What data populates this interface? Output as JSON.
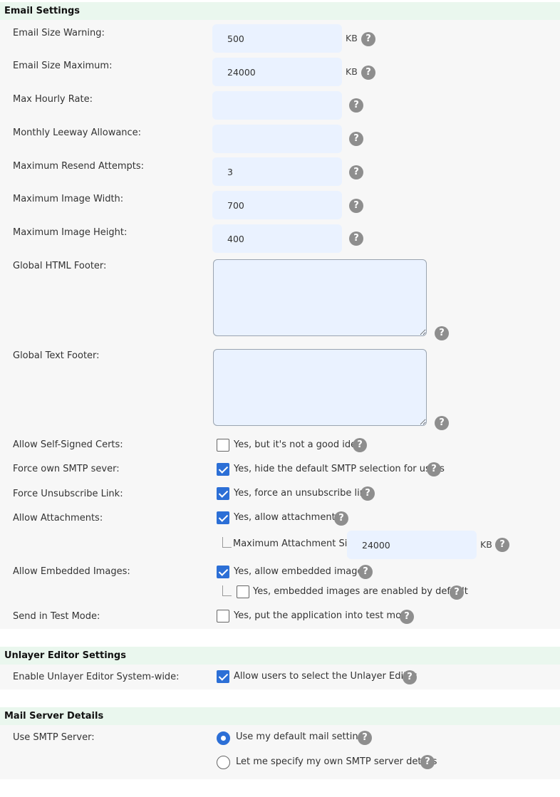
{
  "help_glyph": "?",
  "email_settings": {
    "title": "Email Settings",
    "size_warning": {
      "label": "Email Size Warning:",
      "value": "500",
      "unit": "KB"
    },
    "size_maximum": {
      "label": "Email Size Maximum:",
      "value": "24000",
      "unit": "KB"
    },
    "max_hourly_rate": {
      "label": "Max Hourly Rate:",
      "value": ""
    },
    "monthly_leeway": {
      "label": "Monthly Leeway Allowance:",
      "value": ""
    },
    "max_resend": {
      "label": "Maximum Resend Attempts:",
      "value": "3"
    },
    "max_image_width": {
      "label": "Maximum Image Width:",
      "value": "700"
    },
    "max_image_height": {
      "label": "Maximum Image Height:",
      "value": "400"
    },
    "html_footer": {
      "label": "Global HTML Footer:",
      "value": ""
    },
    "text_footer": {
      "label": "Global Text Footer:",
      "value": ""
    },
    "self_signed": {
      "label": "Allow Self-Signed Certs:",
      "option": "Yes, but it's not a good idea",
      "checked": false
    },
    "force_smtp": {
      "label": "Force own SMTP sever:",
      "option": "Yes, hide the default SMTP selection for users",
      "checked": true
    },
    "force_unsubscribe": {
      "label": "Force Unsubscribe Link:",
      "option": "Yes, force an unsubscribe link",
      "checked": true
    },
    "attachments": {
      "label": "Allow Attachments:",
      "option": "Yes, allow attachments",
      "checked": true
    },
    "attachment_size": {
      "label": "Maximum Attachment Size",
      "value": "24000",
      "unit": "KB"
    },
    "embedded_images": {
      "label": "Allow Embedded Images:",
      "option": "Yes, allow embedded images",
      "checked": true
    },
    "embedded_default": {
      "option": "Yes, embedded images are enabled by default",
      "checked": false
    },
    "test_mode": {
      "label": "Send in Test Mode:",
      "option": "Yes, put the application into test mode",
      "checked": false
    }
  },
  "unlayer_settings": {
    "title": "Unlayer Editor Settings",
    "enable": {
      "label": "Enable Unlayer Editor System-wide:",
      "option": "Allow users to select the Unlayer Editor",
      "checked": true
    }
  },
  "mail_server": {
    "title": "Mail Server Details",
    "use_smtp": {
      "label": "Use SMTP Server:",
      "options": [
        {
          "label": "Use my default mail settings",
          "selected": true
        },
        {
          "label": "Let me specify my own SMTP server details",
          "selected": false
        }
      ]
    }
  },
  "colors": {
    "header_bg": "#eaf7ee",
    "body_bg": "#f7f7f7",
    "input_bg": "#eaf2ff",
    "accent": "#2c6fd6",
    "help_icon": "#8e8e8e"
  }
}
